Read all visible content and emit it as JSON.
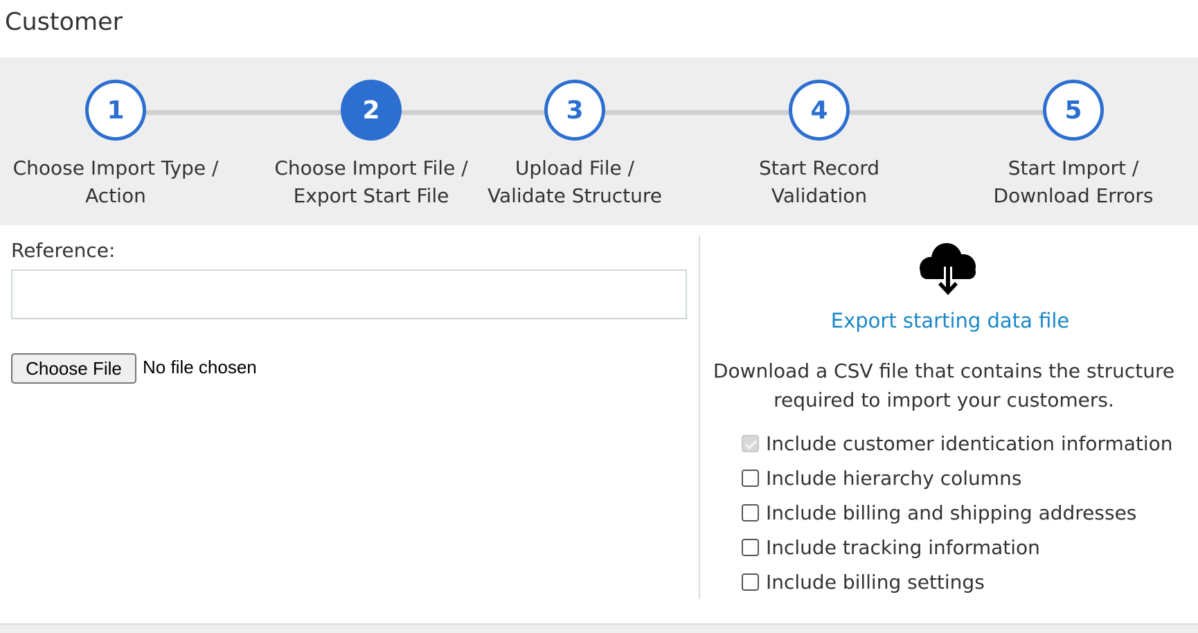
{
  "page": {
    "title": "Customer"
  },
  "stepper": {
    "steps": [
      {
        "number": "1",
        "line1": "Choose Import Type /",
        "line2": "Action",
        "active": false
      },
      {
        "number": "2",
        "line1": "Choose Import File /",
        "line2": "Export Start File",
        "active": true
      },
      {
        "number": "3",
        "line1": "Upload File /",
        "line2": "Validate Structure",
        "active": false
      },
      {
        "number": "4",
        "line1": "Start Record",
        "line2": "Validation",
        "active": false
      },
      {
        "number": "5",
        "line1": "Start Import /",
        "line2": "Download Errors",
        "active": false
      }
    ]
  },
  "form": {
    "reference_label": "Reference:",
    "reference_value": "",
    "choose_file_label": "Choose File",
    "file_status": "No file chosen"
  },
  "export": {
    "icon": "cloud-download-icon",
    "link_label": "Export starting data file",
    "description_line1": "Download a CSV file that contains the structure",
    "description_line2": "required to import your customers.",
    "options": [
      {
        "label": "Include customer identication information",
        "checked": true,
        "disabled": true
      },
      {
        "label": "Include hierarchy columns",
        "checked": false,
        "disabled": false
      },
      {
        "label": "Include billing and shipping addresses",
        "checked": false,
        "disabled": false
      },
      {
        "label": "Include tracking information",
        "checked": false,
        "disabled": false
      },
      {
        "label": "Include billing settings",
        "checked": false,
        "disabled": false
      }
    ]
  },
  "colors": {
    "accent": "#2c6fd1",
    "link": "#1a87c9",
    "stepper_bg": "#eeeeee"
  }
}
